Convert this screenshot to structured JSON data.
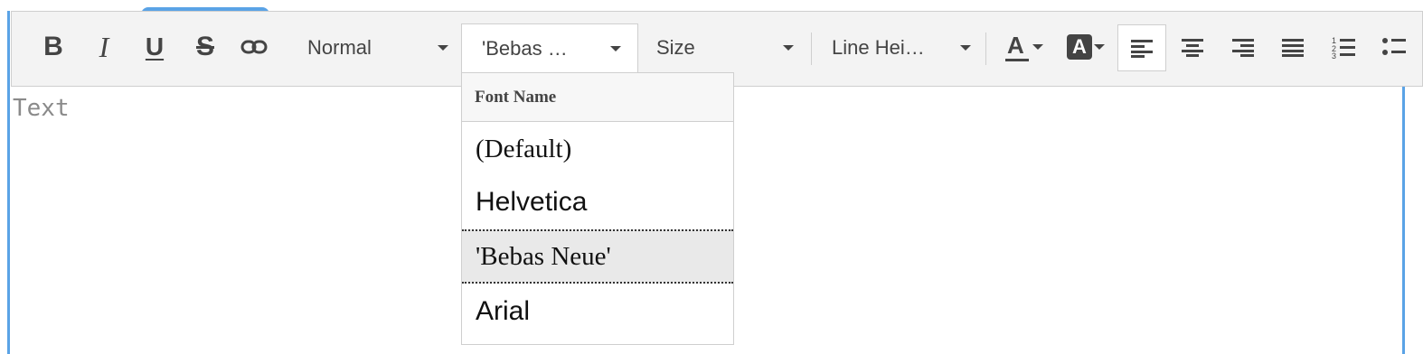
{
  "toolbar": {
    "format_select": "Normal",
    "font_select": "'Bebas …",
    "size_select": "Size",
    "line_height_select": "Line Hei…",
    "bold_glyph": "B",
    "italic_glyph": "I",
    "underline_glyph": "U",
    "strike_glyph": "S",
    "font_color_glyph": "A",
    "bg_color_glyph": "A"
  },
  "editor": {
    "placeholder": "Text"
  },
  "font_dropdown": {
    "header": "Font Name",
    "items": [
      "(Default)",
      "Helvetica",
      "'Bebas Neue'",
      "Arial"
    ],
    "hovered_item": "'Bebas Neue'"
  },
  "colors": {
    "accent": "#5aa3e6",
    "toolbar_bg": "#f3f3f3",
    "border": "#cfcfcf",
    "hover_bg": "#e9e9e9"
  },
  "icons": [
    "link-icon",
    "align-left-icon",
    "align-center-icon",
    "align-right-icon",
    "align-justify-icon",
    "ordered-list-icon",
    "unordered-list-icon"
  ]
}
